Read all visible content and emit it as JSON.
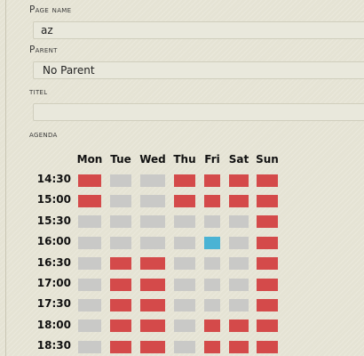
{
  "form": {
    "page_name_label": "Page name",
    "page_name_value": "az",
    "parent_label": "Parent",
    "parent_value": "No Parent",
    "titel_label": "titel",
    "titel_value": "",
    "agenda_label": "agenda"
  },
  "colors": {
    "busy": "#d44a4a",
    "free": "#c9c9c7",
    "selected": "#4ab3d4"
  },
  "agenda": {
    "days": [
      "Mon",
      "Tue",
      "Wed",
      "Thu",
      "Fri",
      "Sat",
      "Sun"
    ],
    "times": [
      "14:30",
      "15:00",
      "15:30",
      "16:00",
      "16:30",
      "17:00",
      "17:30",
      "18:00",
      "18:30"
    ],
    "slots": [
      [
        "busy",
        "free",
        "free",
        "busy",
        "busy",
        "busy",
        "busy"
      ],
      [
        "busy",
        "free",
        "free",
        "busy",
        "busy",
        "busy",
        "busy"
      ],
      [
        "free",
        "free",
        "free",
        "free",
        "free",
        "free",
        "busy"
      ],
      [
        "free",
        "free",
        "free",
        "free",
        "selected",
        "free",
        "busy"
      ],
      [
        "free",
        "busy",
        "busy",
        "free",
        "free",
        "free",
        "busy"
      ],
      [
        "free",
        "busy",
        "busy",
        "free",
        "free",
        "free",
        "busy"
      ],
      [
        "free",
        "busy",
        "busy",
        "free",
        "free",
        "free",
        "busy"
      ],
      [
        "free",
        "busy",
        "busy",
        "free",
        "busy",
        "busy",
        "busy"
      ],
      [
        "free",
        "busy",
        "busy",
        "free",
        "busy",
        "busy",
        "busy"
      ]
    ]
  }
}
